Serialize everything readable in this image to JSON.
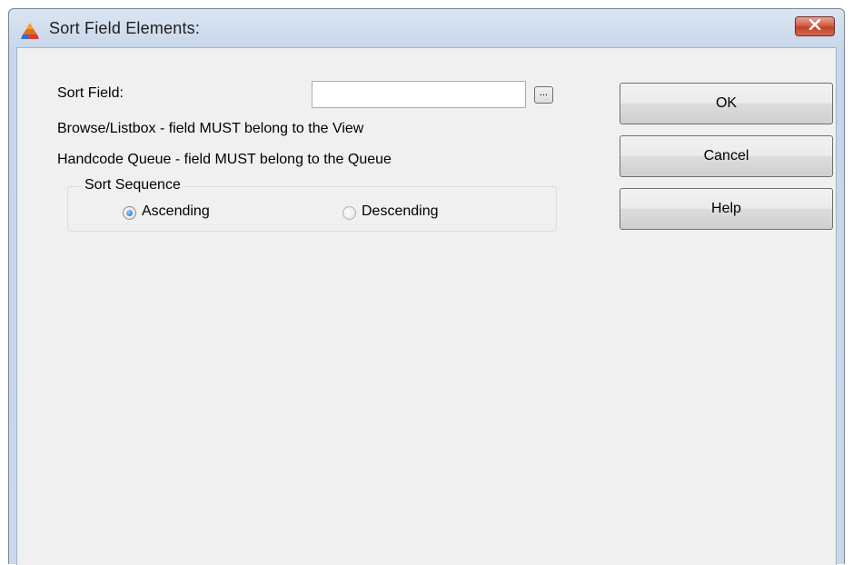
{
  "window": {
    "title": "Sort Field Elements:"
  },
  "form": {
    "sort_field_label": "Sort Field:",
    "sort_field_value": "",
    "lookup_button_label": "...",
    "note_browse": "Browse/Listbox - field MUST belong to the View",
    "note_handcode": "Handcode Queue - field MUST belong to the Queue"
  },
  "sort_sequence": {
    "legend": "Sort Sequence",
    "options": [
      {
        "label": "Ascending",
        "selected": true
      },
      {
        "label": "Descending",
        "selected": false
      }
    ]
  },
  "buttons": {
    "ok": "OK",
    "cancel": "Cancel",
    "help": "Help"
  },
  "icons": {
    "app": "app-pyramid-icon",
    "close": "close-icon",
    "radio_checked": "radio-checked-icon",
    "radio_unchecked": "radio-unchecked-icon"
  },
  "colors": {
    "titlebar": "#c7d6ea",
    "client": "#f0f0f0",
    "close_button": "#c1412b"
  }
}
